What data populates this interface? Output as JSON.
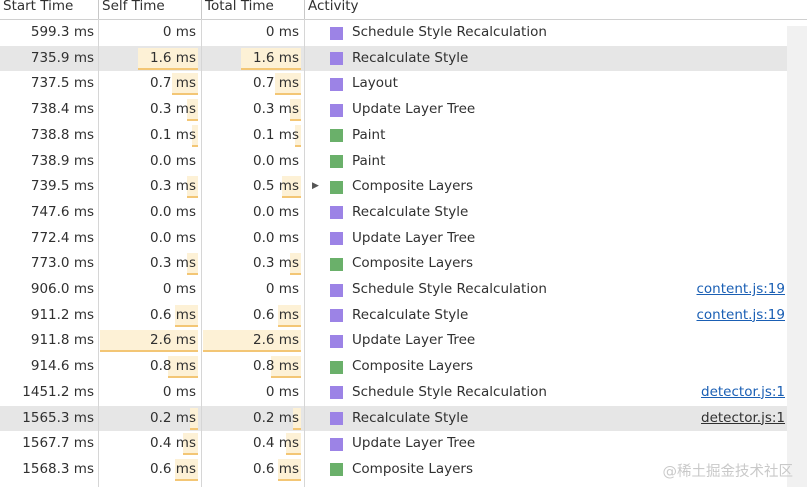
{
  "columns": {
    "start": "Start Time",
    "self": "Self Time",
    "total": "Total Time",
    "activity": "Activity"
  },
  "colors": {
    "rendering": "#9c83e6",
    "painting": "#6ab06a",
    "bar_fill": "#fdf1d6",
    "bar_line": "#f3c675"
  },
  "rows": [
    {
      "start": "599.3 ms",
      "self": "0 ms",
      "total": "0 ms",
      "activity": "Schedule Style Recalculation",
      "kind": "rendering",
      "link": ""
    },
    {
      "start": "735.9 ms",
      "self": "1.6 ms",
      "total": "1.6 ms",
      "activity": "Recalculate Style",
      "kind": "rendering",
      "link": "",
      "selected": true
    },
    {
      "start": "737.5 ms",
      "self": "0.7 ms",
      "total": "0.7 ms",
      "activity": "Layout",
      "kind": "rendering",
      "link": ""
    },
    {
      "start": "738.4 ms",
      "self": "0.3 ms",
      "total": "0.3 ms",
      "activity": "Update Layer Tree",
      "kind": "rendering",
      "link": ""
    },
    {
      "start": "738.8 ms",
      "self": "0.1 ms",
      "total": "0.1 ms",
      "activity": "Paint",
      "kind": "painting",
      "link": ""
    },
    {
      "start": "738.9 ms",
      "self": "0.0 ms",
      "total": "0.0 ms",
      "activity": "Paint",
      "kind": "painting",
      "link": ""
    },
    {
      "start": "739.5 ms",
      "self": "0.3 ms",
      "total": "0.5 ms",
      "activity": "Composite Layers",
      "kind": "painting",
      "link": "",
      "expandable": true
    },
    {
      "start": "747.6 ms",
      "self": "0.0 ms",
      "total": "0.0 ms",
      "activity": "Recalculate Style",
      "kind": "rendering",
      "link": ""
    },
    {
      "start": "772.4 ms",
      "self": "0.0 ms",
      "total": "0.0 ms",
      "activity": "Update Layer Tree",
      "kind": "rendering",
      "link": ""
    },
    {
      "start": "773.0 ms",
      "self": "0.3 ms",
      "total": "0.3 ms",
      "activity": "Composite Layers",
      "kind": "painting",
      "link": ""
    },
    {
      "start": "906.0 ms",
      "self": "0 ms",
      "total": "0 ms",
      "activity": "Schedule Style Recalculation",
      "kind": "rendering",
      "link": "content.js:19"
    },
    {
      "start": "911.2 ms",
      "self": "0.6 ms",
      "total": "0.6 ms",
      "activity": "Recalculate Style",
      "kind": "rendering",
      "link": "content.js:19"
    },
    {
      "start": "911.8 ms",
      "self": "2.6 ms",
      "total": "2.6 ms",
      "activity": "Update Layer Tree",
      "kind": "rendering",
      "link": ""
    },
    {
      "start": "914.6 ms",
      "self": "0.8 ms",
      "total": "0.8 ms",
      "activity": "Composite Layers",
      "kind": "painting",
      "link": ""
    },
    {
      "start": "1451.2 ms",
      "self": "0 ms",
      "total": "0 ms",
      "activity": "Schedule Style Recalculation",
      "kind": "rendering",
      "link": "detector.js:1"
    },
    {
      "start": "1565.3 ms",
      "self": "0.2 ms",
      "total": "0.2 ms",
      "activity": "Recalculate Style",
      "kind": "rendering",
      "link": "detector.js:1",
      "selected": true
    },
    {
      "start": "1567.7 ms",
      "self": "0.4 ms",
      "total": "0.4 ms",
      "activity": "Update Layer Tree",
      "kind": "rendering",
      "link": ""
    },
    {
      "start": "1568.3 ms",
      "self": "0.6 ms",
      "total": "0.6 ms",
      "activity": "Composite Layers",
      "kind": "painting",
      "link": ""
    }
  ],
  "watermark": "@稀土掘金技术社区"
}
